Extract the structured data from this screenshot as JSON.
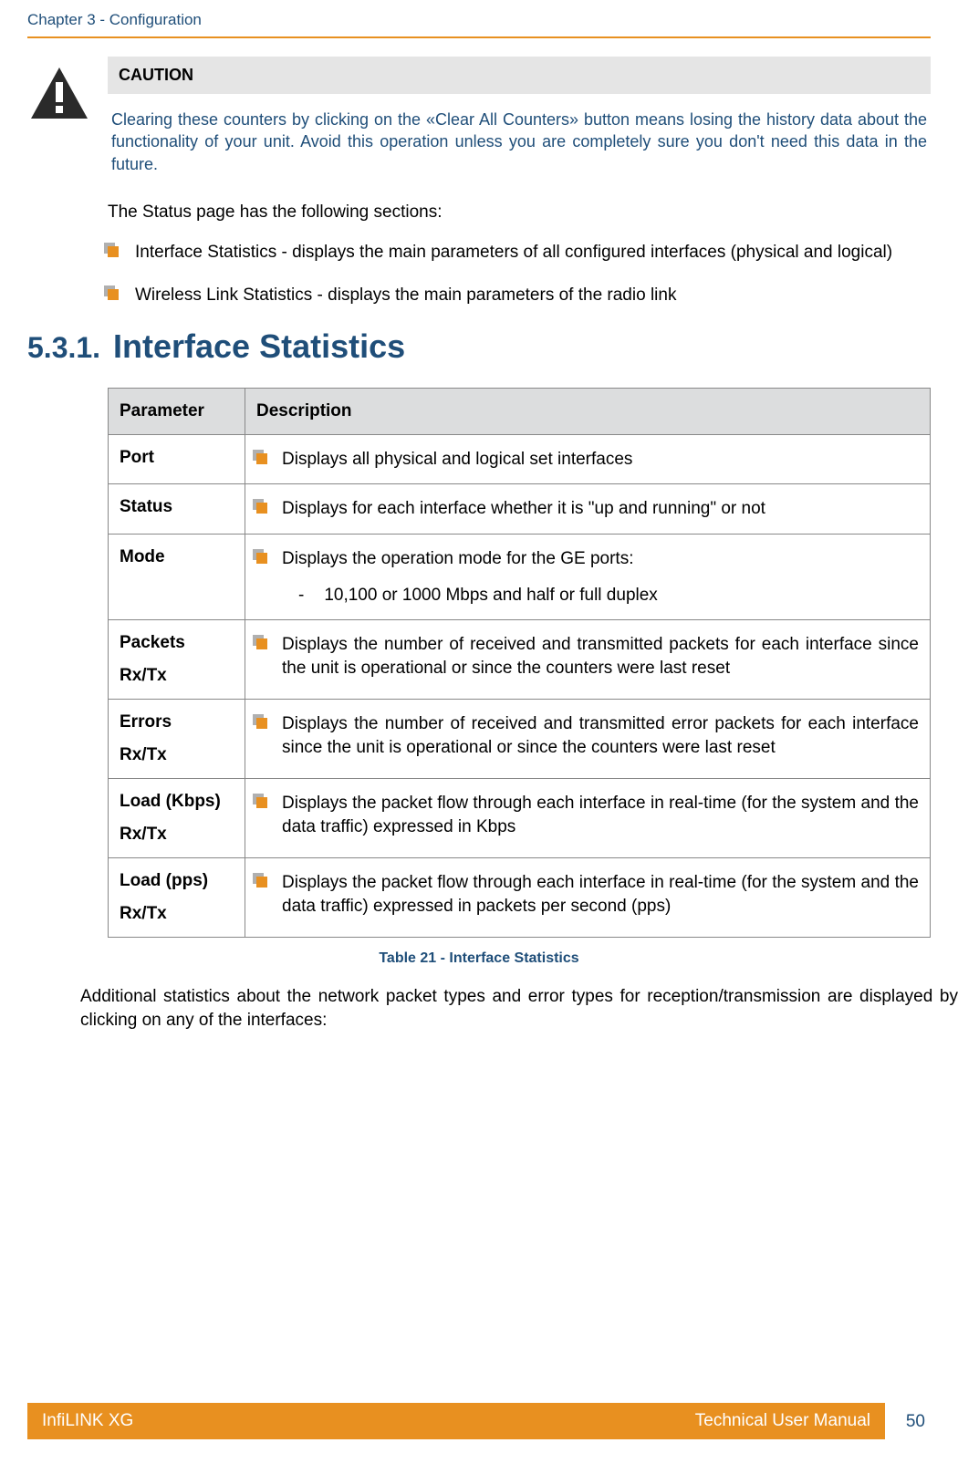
{
  "header": {
    "chapterTitle": "Chapter 3 - Configuration"
  },
  "caution": {
    "label": "CAUTION",
    "text": "Clearing these counters by clicking on the «Clear All Counters» button means losing the history data about the functionality of your unit. Avoid this operation unless you are completely sure you don't need this data in the future."
  },
  "intro": {
    "lead": "The Status page has the following sections:",
    "bullets": [
      "Interface Statistics - displays the main parameters of all configured interfaces (physical and logical)",
      "Wireless Link Statistics - displays the main parameters of the radio link"
    ]
  },
  "section": {
    "number": "5.3.1.",
    "title": "Interface Statistics"
  },
  "table": {
    "headers": [
      "Parameter",
      "Description"
    ],
    "rows": [
      {
        "param": "Port",
        "paramSub": "",
        "desc": "Displays all physical and logical set interfaces",
        "sub": ""
      },
      {
        "param": "Status",
        "paramSub": "",
        "desc": "Displays for each interface whether it is \"up and running\" or not",
        "sub": ""
      },
      {
        "param": "Mode",
        "paramSub": "",
        "desc": "Displays the operation mode for the GE ports:",
        "sub": "10,100 or 1000 Mbps and half or full duplex"
      },
      {
        "param": "Packets",
        "paramSub": "Rx/Tx",
        "desc": "Displays the number of received and transmitted packets for each interface since the unit is operational or since the counters were last reset",
        "sub": ""
      },
      {
        "param": "Errors",
        "paramSub": "Rx/Tx",
        "desc": "Displays the number of received and transmitted error packets for each interface since the unit is operational or since the counters were last reset",
        "sub": ""
      },
      {
        "param": "Load (Kbps)",
        "paramSub": "Rx/Tx",
        "desc": "Displays the packet flow through each interface in real-time (for the system and the data traffic) expressed in Kbps",
        "sub": ""
      },
      {
        "param": "Load (pps)",
        "paramSub": "Rx/Tx",
        "desc": "Displays the packet flow through each interface in real-time (for the system and the data traffic) expressed in packets per second (pps)",
        "sub": ""
      }
    ],
    "caption": "Table 21 - Interface Statistics"
  },
  "closingText": "Additional statistics about the network packet types and error types for reception/transmission are displayed by clicking on any of the interfaces:",
  "footer": {
    "left": "InfiLINK XG",
    "right": "Technical User Manual",
    "pageNumber": "50"
  }
}
